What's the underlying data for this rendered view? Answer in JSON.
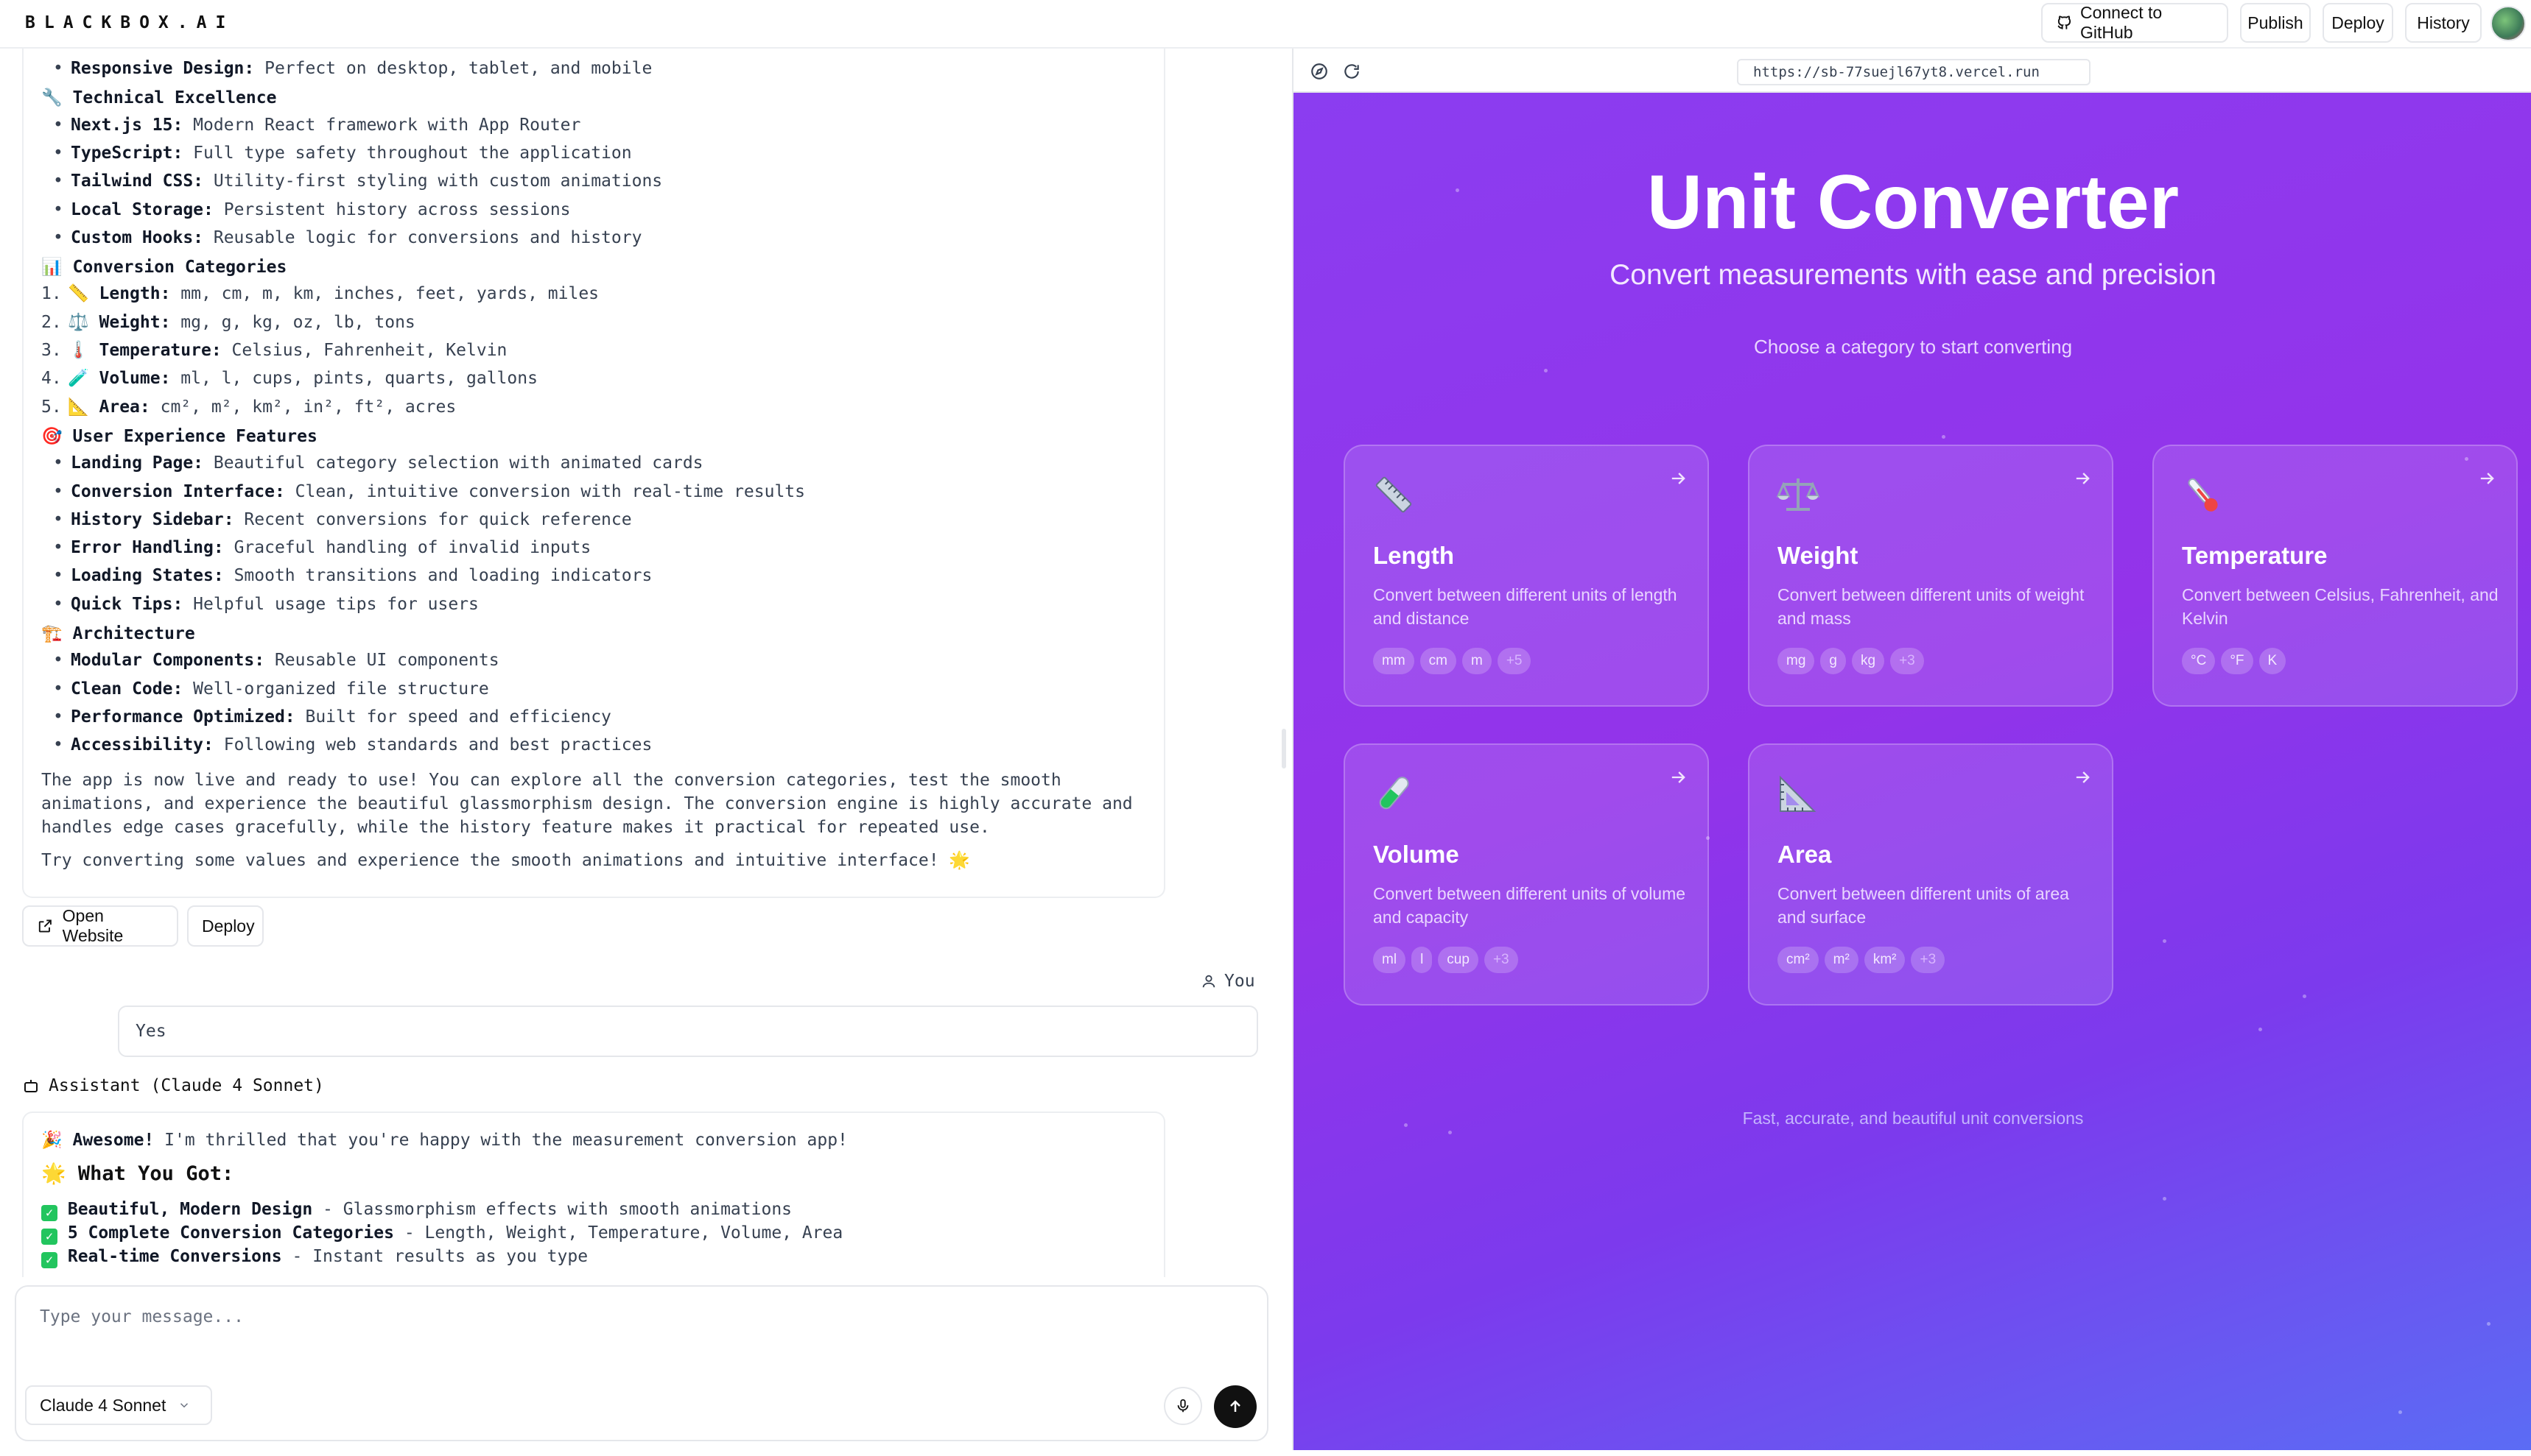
{
  "brand": "BLACKBOX.AI",
  "topbar": {
    "connect": "Connect to GitHub",
    "publish": "Publish",
    "deploy": "Deploy",
    "history": "History"
  },
  "message1": {
    "lines": [
      {
        "kind": "bullet",
        "bold": "Responsive Design:",
        "text": " Perfect on desktop, tablet, and mobile"
      },
      {
        "kind": "heading",
        "icon": "🔧",
        "text": "Technical Excellence"
      },
      {
        "kind": "bullet",
        "bold": "Next.js 15:",
        "text": " Modern React framework with App Router"
      },
      {
        "kind": "bullet",
        "bold": "TypeScript:",
        "text": " Full type safety throughout the application"
      },
      {
        "kind": "bullet",
        "bold": "Tailwind CSS:",
        "text": " Utility-first styling with custom animations"
      },
      {
        "kind": "bullet",
        "bold": "Local Storage:",
        "text": " Persistent history across sessions"
      },
      {
        "kind": "bullet",
        "bold": "Custom Hooks:",
        "text": " Reusable logic for conversions and history"
      },
      {
        "kind": "heading",
        "icon": "📊",
        "text": "Conversion Categories"
      },
      {
        "kind": "num",
        "n": "1.",
        "icon": "📏",
        "bold": "Length:",
        "text": " mm, cm, m, km, inches, feet, yards, miles"
      },
      {
        "kind": "num",
        "n": "2.",
        "icon": "⚖️",
        "bold": "Weight:",
        "text": " mg, g, kg, oz, lb, tons"
      },
      {
        "kind": "num",
        "n": "3.",
        "icon": "🌡️",
        "bold": "Temperature:",
        "text": " Celsius, Fahrenheit, Kelvin"
      },
      {
        "kind": "num",
        "n": "4.",
        "icon": "🧪",
        "bold": "Volume:",
        "text": " ml, l, cups, pints, quarts, gallons"
      },
      {
        "kind": "num",
        "n": "5.",
        "icon": "📐",
        "bold": "Area:",
        "text": " cm², m², km², in², ft², acres"
      },
      {
        "kind": "heading",
        "icon": "🎯",
        "text": "User Experience Features"
      },
      {
        "kind": "bullet",
        "bold": "Landing Page:",
        "text": " Beautiful category selection with animated cards"
      },
      {
        "kind": "bullet",
        "bold": "Conversion Interface:",
        "text": " Clean, intuitive conversion with real-time results"
      },
      {
        "kind": "bullet",
        "bold": "History Sidebar:",
        "text": " Recent conversions for quick reference"
      },
      {
        "kind": "bullet",
        "bold": "Error Handling:",
        "text": " Graceful handling of invalid inputs"
      },
      {
        "kind": "bullet",
        "bold": "Loading States:",
        "text": " Smooth transitions and loading indicators"
      },
      {
        "kind": "bullet",
        "bold": "Quick Tips:",
        "text": " Helpful usage tips for users"
      },
      {
        "kind": "heading",
        "icon": "🏗️",
        "text": "Architecture"
      },
      {
        "kind": "bullet",
        "bold": "Modular Components:",
        "text": " Reusable UI components"
      },
      {
        "kind": "bullet",
        "bold": "Clean Code:",
        "text": " Well-organized file structure"
      },
      {
        "kind": "bullet",
        "bold": "Performance Optimized:",
        "text": " Built for speed and efficiency"
      },
      {
        "kind": "bullet",
        "bold": "Accessibility:",
        "text": " Following web standards and best practices"
      }
    ],
    "para1": [
      "The app is now live and ready to use! You can explore all the conversion categories, test the smooth",
      "animations, and experience the beautiful glassmorphism design. The conversion engine is highly accurate and",
      "handles edge cases gracefully, while the history feature makes it practical for repeated use."
    ],
    "para2": "Try converting some values and experience the smooth animations and intuitive interface! 🌟"
  },
  "actions": {
    "open_website": "Open Website",
    "deploy": "Deploy"
  },
  "user": {
    "label": "You",
    "message": "Yes"
  },
  "assistant": {
    "label": "Assistant (Claude 4 Sonnet)"
  },
  "message2": {
    "intro_icon": "🎉",
    "intro_bold": "Awesome!",
    "intro_text": " I'm thrilled that you're happy with the measurement conversion app!",
    "heading_icon": "🌟",
    "heading": "What You Got:",
    "items": [
      {
        "bold": "Beautiful, Modern Design",
        "text": " - Glassmorphism effects with smooth animations"
      },
      {
        "bold": "5 Complete Conversion Categories",
        "text": " - Length, Weight, Temperature, Volume, Area"
      },
      {
        "bold": "Real-time Conversions",
        "text": " - Instant results as you type"
      }
    ]
  },
  "composer": {
    "placeholder": "Type your message...",
    "model": "Claude 4 Sonnet"
  },
  "preview": {
    "url": "https://sb-77suejl67yt8.vercel.run",
    "title": "Unit Converter",
    "subtitle": "Convert measurements with ease and precision",
    "choose": "Choose a category to start converting",
    "footer": "Fast, accurate, and beautiful unit conversions",
    "cards": [
      {
        "icon": "ruler-icon",
        "title": "Length",
        "desc": "Convert between different units of length and distance",
        "chips": [
          "mm",
          "cm",
          "m"
        ],
        "more": "+5"
      },
      {
        "icon": "scale-icon",
        "title": "Weight",
        "desc": "Convert between different units of weight and mass",
        "chips": [
          "mg",
          "g",
          "kg"
        ],
        "more": "+3"
      },
      {
        "icon": "thermometer-icon",
        "title": "Temperature",
        "desc": "Convert between Celsius, Fahrenheit, and Kelvin",
        "chips": [
          "°C",
          "°F",
          "K"
        ],
        "more": ""
      },
      {
        "icon": "test-tube-icon",
        "title": "Volume",
        "desc": "Convert between different units of volume and capacity",
        "chips": [
          "ml",
          "l",
          "cup"
        ],
        "more": "+3"
      },
      {
        "icon": "triangle-ruler-icon",
        "title": "Area",
        "desc": "Convert between different units of area and surface",
        "chips": [
          "cm²",
          "m²",
          "km²"
        ],
        "more": "+3"
      }
    ]
  }
}
